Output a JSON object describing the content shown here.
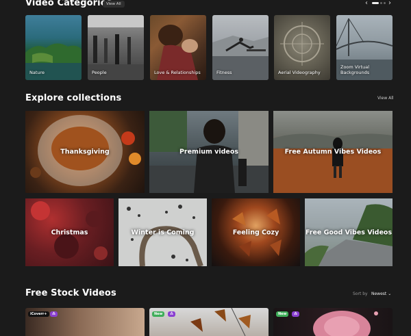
{
  "categories": {
    "title": "Video Categories",
    "view_all": "View All",
    "items": [
      {
        "label": "Nature"
      },
      {
        "label": "People"
      },
      {
        "label": "Love & Relationships"
      },
      {
        "label": "Fitness"
      },
      {
        "label": "Aerial Videography"
      },
      {
        "label": "Zoom Virtual Backgrounds"
      }
    ]
  },
  "collections": {
    "title": "Explore collections",
    "view_all": "View All",
    "items": [
      {
        "label": "Thanksgiving"
      },
      {
        "label": "Premium videos"
      },
      {
        "label": "Free Autumn Vibes Videos"
      },
      {
        "label": "Christmas"
      },
      {
        "label": "Winter is Coming"
      },
      {
        "label": "Feeling Cozy"
      },
      {
        "label": "Free Good Vibes Videos"
      }
    ]
  },
  "stock": {
    "title": "Free Stock Videos",
    "sort_label": "Sort by",
    "sort_value": "Newest",
    "badges": {
      "brand": "iCoverr+",
      "new": "New"
    }
  },
  "colors": {
    "background": "#1b1b1b",
    "new_badge": "#3fae5a",
    "brand_badge": "#8a3fd1"
  }
}
